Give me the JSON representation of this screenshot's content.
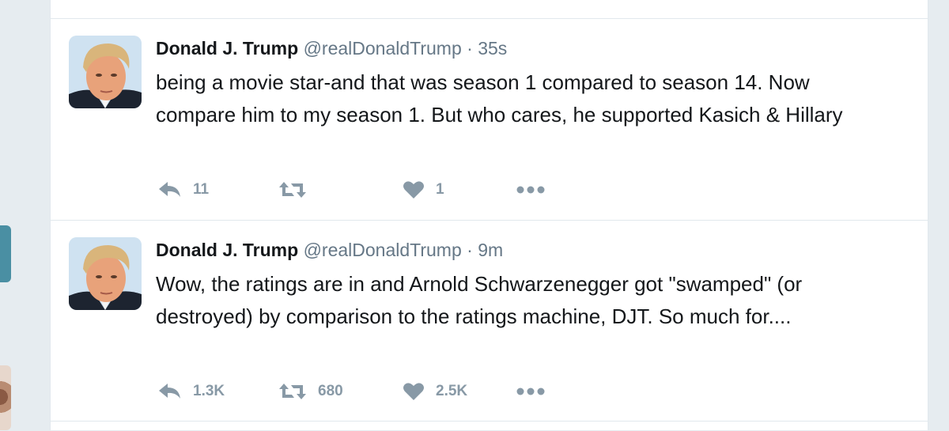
{
  "tweets": [
    {
      "name": "Donald J. Trump",
      "handle": "@realDonaldTrump",
      "separator": "·",
      "time": "35s",
      "text": "being a movie star-and that was season 1 compared to season 14. Now compare him to my season 1. But who cares, he supported Kasich & Hillary",
      "replies": "11",
      "retweets": "",
      "likes": "1"
    },
    {
      "name": "Donald J. Trump",
      "handle": "@realDonaldTrump",
      "separator": "·",
      "time": "9m",
      "text": "Wow, the ratings are in and Arnold Schwarzenegger got \"swamped\" (or destroyed) by comparison to the ratings machine, DJT. So much for....",
      "replies": "1.3K",
      "retweets": "680",
      "likes": "2.5K"
    }
  ],
  "icons": {
    "reply": "reply-icon",
    "retweet": "retweet-icon",
    "like": "heart-icon",
    "more": "more-dots-icon"
  },
  "colors": {
    "icon_gray": "#8899a6",
    "handle_gray": "#657786",
    "border": "#e1e8ed"
  }
}
